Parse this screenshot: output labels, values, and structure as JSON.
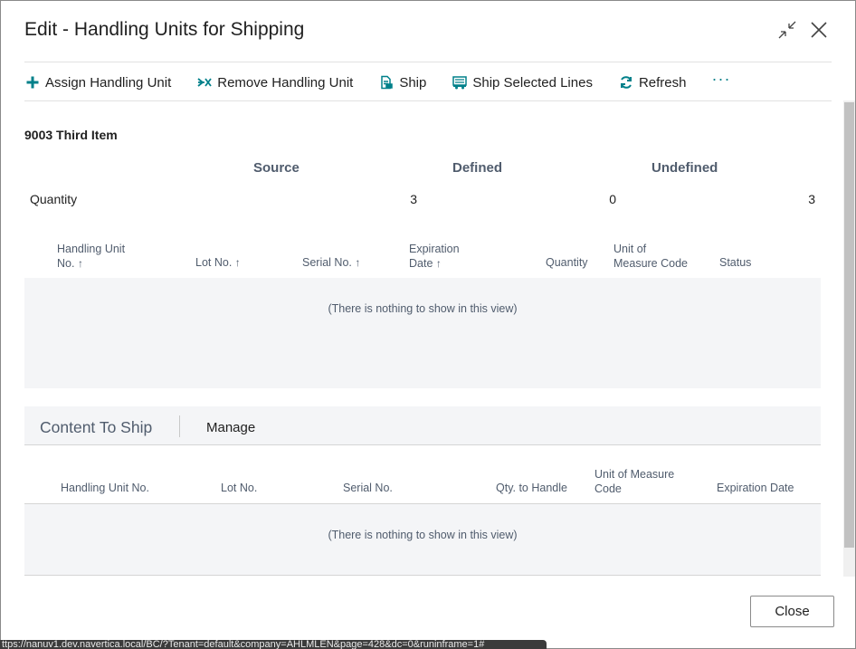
{
  "dialog": {
    "title": "Edit - Handling Units for Shipping",
    "collapse_icon": "collapse-arrows-icon",
    "close_icon": "close-x-icon"
  },
  "toolbar": {
    "items": [
      {
        "label": "Assign Handling Unit",
        "icon": "plus-icon"
      },
      {
        "label": "Remove Handling Unit",
        "icon": "remove-arrow-icon"
      },
      {
        "label": "Ship",
        "icon": "document-ship-icon"
      },
      {
        "label": "Ship Selected Lines",
        "icon": "truck-lines-icon"
      },
      {
        "label": "Refresh",
        "icon": "refresh-icon"
      }
    ],
    "more": "···"
  },
  "item": {
    "title": "9003 Third Item"
  },
  "summary": {
    "headers": {
      "source": "Source",
      "defined": "Defined",
      "undefined": "Undefined"
    },
    "row_label": "Quantity",
    "source": "3",
    "defined": "0",
    "undefined": "3"
  },
  "grid1": {
    "columns": {
      "hu_no_line1": "Handling Unit",
      "hu_no_line2": "No.",
      "lot": "Lot No.",
      "serial": "Serial No.",
      "exp_line1": "Expiration",
      "exp_line2": "Date",
      "quantity": "Quantity",
      "uom_line1": "Unit of",
      "uom_line2": "Measure Code",
      "status": "Status",
      "sort_arrow": "↑"
    },
    "empty_message": "(There is nothing to show in this view)"
  },
  "content_part": {
    "title": "Content To Ship",
    "manage": "Manage",
    "columns": {
      "hu_no": "Handling Unit No.",
      "lot": "Lot No.",
      "serial": "Serial No.",
      "qty_handle": "Qty. to Handle",
      "uom_line1": "Unit of Measure",
      "uom_line2": "Code",
      "exp": "Expiration Date"
    },
    "empty_message": "(There is nothing to show in this view)"
  },
  "footer": {
    "close_label": "Close"
  },
  "status_bar": {
    "url": "ttps://nanuv1.dev.navertica.local/BC/?Tenant=default&company=AHLMLEN&page=428&dc=0&runinframe=1#"
  },
  "colors": {
    "accent": "#00808a",
    "header_text": "#505c6d",
    "empty_bg": "#f4f5f7"
  }
}
